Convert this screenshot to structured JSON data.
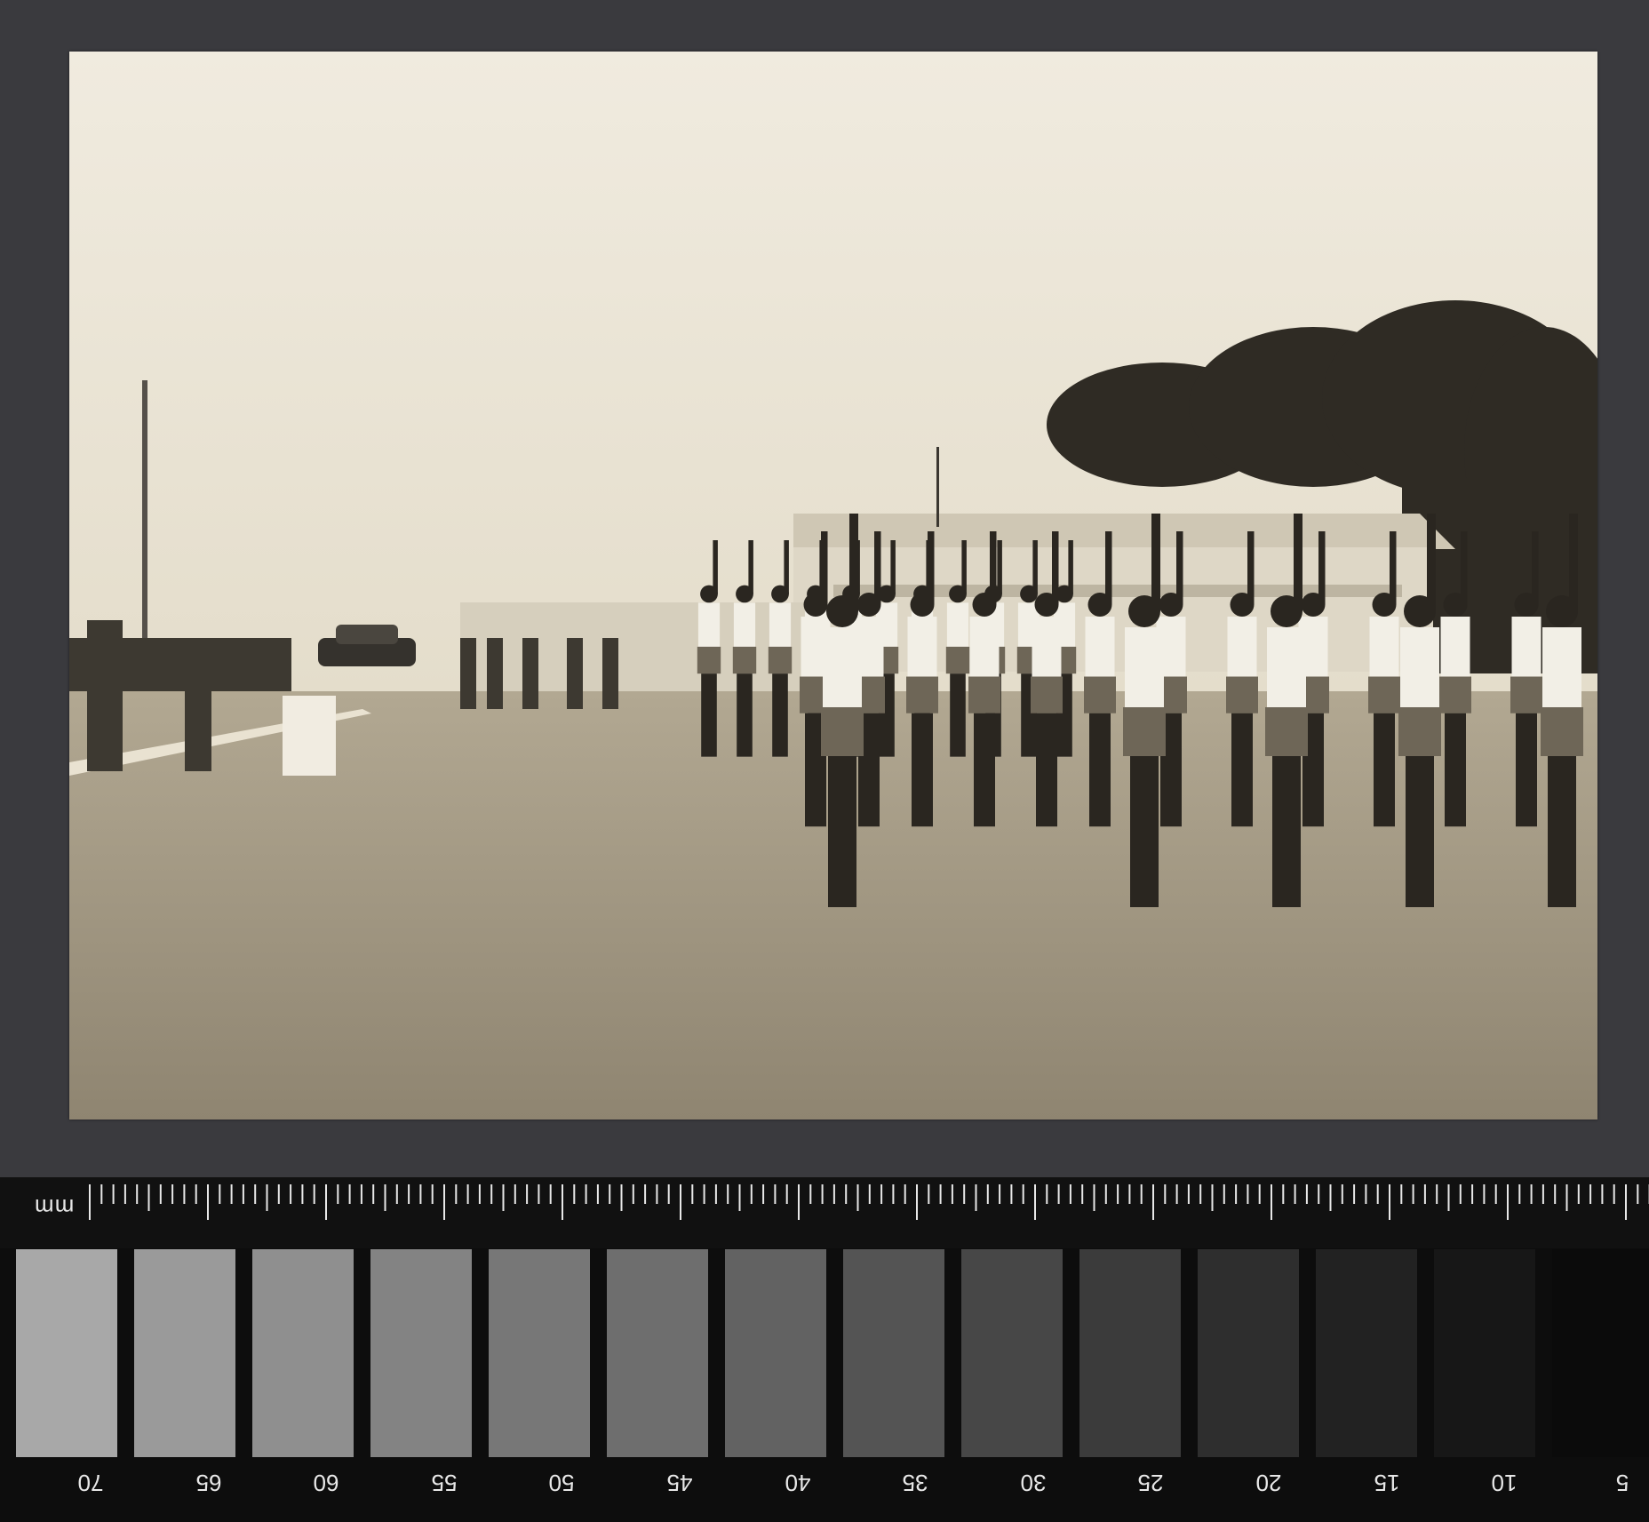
{
  "ruler": {
    "unit_label": "mm",
    "scale_numbers": [
      "70",
      "65",
      "60",
      "55",
      "50",
      "45",
      "40",
      "35",
      "30",
      "25",
      "20",
      "15",
      "10",
      "5"
    ]
  },
  "gray_patches": [
    "#a8a8a8",
    "#9a9a9a",
    "#8f8f8f",
    "#838383",
    "#777777",
    "#6e6e6e",
    "#626262",
    "#545454",
    "#474747",
    "#3b3b3b",
    "#2e2e2e",
    "#222222",
    "#171717",
    "#0b0b0b"
  ],
  "photo": {
    "description_tag": "black-and-white photograph",
    "tone": "#ece6d6"
  }
}
